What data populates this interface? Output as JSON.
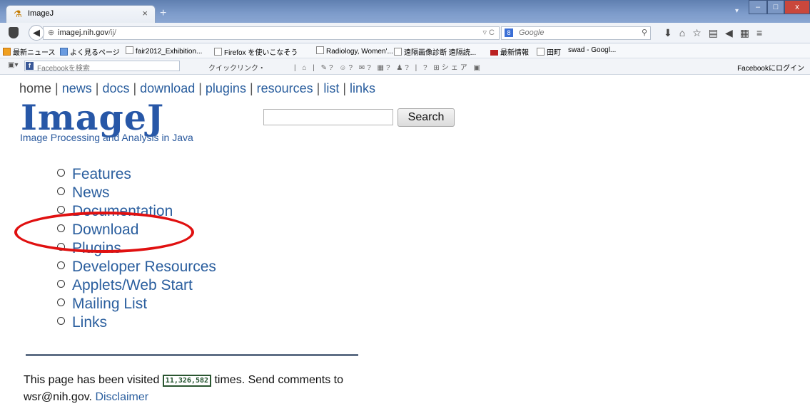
{
  "browser": {
    "tab_title": "ImageJ",
    "tab_close": "×",
    "new_tab": "+",
    "url_host": "imagej.nih.gov",
    "url_path": "/ij/",
    "url_right": "▿ C",
    "search_engine_placeholder": "Google",
    "bookmarks": [
      "最新ニュース",
      "よく見るページ",
      "fair2012_Exhibition...",
      "Firefox を使いこなそう",
      "Radiology, Women'...",
      "遠隔画像診断 遠隔読...",
      "最新情報",
      "田町",
      "swad - Googl..."
    ],
    "facebook_search_placeholder": "Facebookを検索",
    "quick_link": "クイックリンク・",
    "share": "シェア",
    "facebook_login": "Facebookにログイン"
  },
  "page": {
    "nav": [
      "home",
      "news",
      "docs",
      "download",
      "plugins",
      "resources",
      "list",
      "links"
    ],
    "logo": "ImageJ",
    "tagline": "Image Processing and Analysis in Java",
    "search_button": "Search",
    "menu": [
      "Features",
      "News",
      "Documentation",
      "Download",
      "Plugins",
      "Developer Resources",
      "Applets/Web Start",
      "Mailing List",
      "Links"
    ],
    "footer_prefix": "This page has been visited",
    "visit_count": "11,326,582",
    "footer_suffix": "times. Send comments to wsr@nih.gov.",
    "disclaimer": "Disclaimer"
  },
  "annotation": {
    "highlight_color": "#e01010"
  }
}
